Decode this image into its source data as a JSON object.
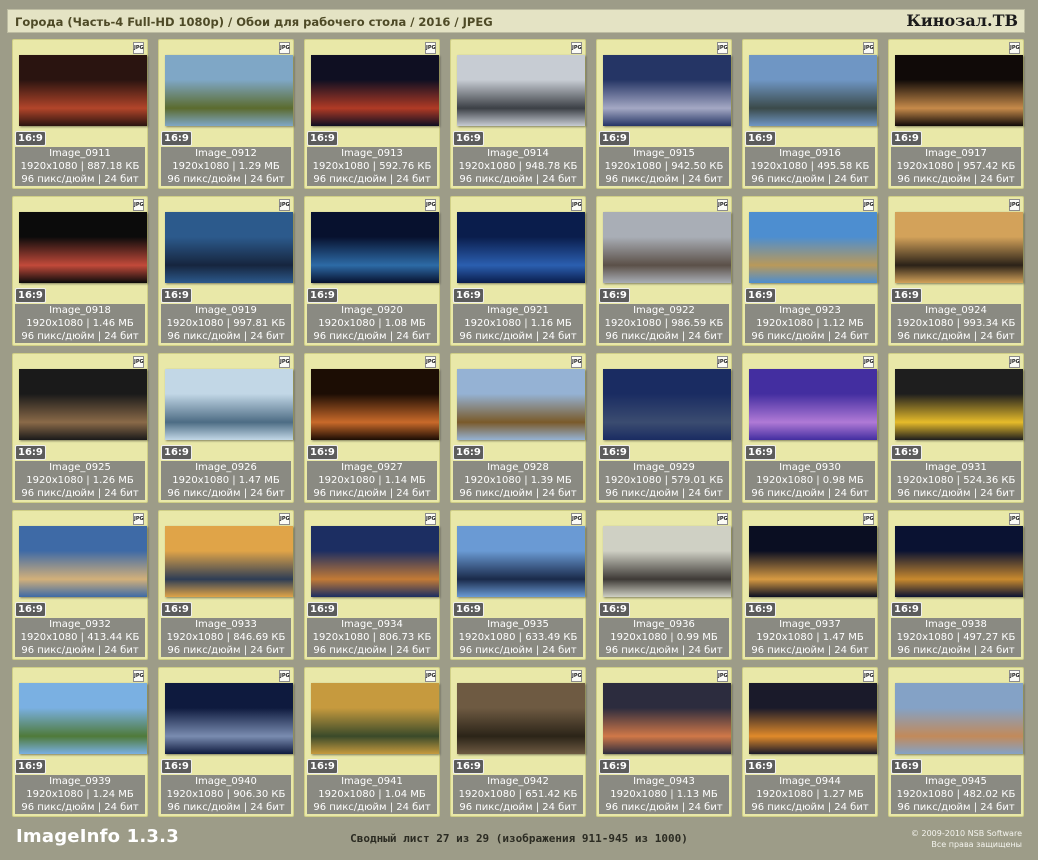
{
  "header": {
    "title": "Города (Часть-4 Full-HD 1080p) / Обои для рабочего стола / 2016 / JPEG",
    "brand": "Кинозал.ТВ"
  },
  "tile_format_badge": "JPG",
  "images": [
    {
      "name": "Image_0911",
      "aspect": "16:9",
      "dims": "1920x1080 | 887.18 КБ",
      "meta": "96 пикс/дюйм | 24 бит"
    },
    {
      "name": "Image_0912",
      "aspect": "16:9",
      "dims": "1920x1080 | 1.29 МБ",
      "meta": "96 пикс/дюйм | 24 бит"
    },
    {
      "name": "Image_0913",
      "aspect": "16:9",
      "dims": "1920x1080 | 592.76 КБ",
      "meta": "96 пикс/дюйм | 24 бит"
    },
    {
      "name": "Image_0914",
      "aspect": "16:9",
      "dims": "1920x1080 | 948.78 КБ",
      "meta": "96 пикс/дюйм | 24 бит"
    },
    {
      "name": "Image_0915",
      "aspect": "16:9",
      "dims": "1920x1080 | 942.50 КБ",
      "meta": "96 пикс/дюйм | 24 бит"
    },
    {
      "name": "Image_0916",
      "aspect": "16:9",
      "dims": "1920x1080 | 495.58 КБ",
      "meta": "96 пикс/дюйм | 24 бит"
    },
    {
      "name": "Image_0917",
      "aspect": "16:9",
      "dims": "1920x1080 | 957.42 КБ",
      "meta": "96 пикс/дюйм | 24 бит"
    },
    {
      "name": "Image_0918",
      "aspect": "16:9",
      "dims": "1920x1080 | 1.46 МБ",
      "meta": "96 пикс/дюйм | 24 бит"
    },
    {
      "name": "Image_0919",
      "aspect": "16:9",
      "dims": "1920x1080 | 997.81 КБ",
      "meta": "96 пикс/дюйм | 24 бит"
    },
    {
      "name": "Image_0920",
      "aspect": "16:9",
      "dims": "1920x1080 | 1.08 МБ",
      "meta": "96 пикс/дюйм | 24 бит"
    },
    {
      "name": "Image_0921",
      "aspect": "16:9",
      "dims": "1920x1080 | 1.16 МБ",
      "meta": "96 пикс/дюйм | 24 бит"
    },
    {
      "name": "Image_0922",
      "aspect": "16:9",
      "dims": "1920x1080 | 986.59 КБ",
      "meta": "96 пикс/дюйм | 24 бит"
    },
    {
      "name": "Image_0923",
      "aspect": "16:9",
      "dims": "1920x1080 | 1.12 МБ",
      "meta": "96 пикс/дюйм | 24 бит"
    },
    {
      "name": "Image_0924",
      "aspect": "16:9",
      "dims": "1920x1080 | 993.34 КБ",
      "meta": "96 пикс/дюйм | 24 бит"
    },
    {
      "name": "Image_0925",
      "aspect": "16:9",
      "dims": "1920x1080 | 1.26 МБ",
      "meta": "96 пикс/дюйм | 24 бит"
    },
    {
      "name": "Image_0926",
      "aspect": "16:9",
      "dims": "1920x1080 | 1.47 МБ",
      "meta": "96 пикс/дюйм | 24 бит"
    },
    {
      "name": "Image_0927",
      "aspect": "16:9",
      "dims": "1920x1080 | 1.14 МБ",
      "meta": "96 пикс/дюйм | 24 бит"
    },
    {
      "name": "Image_0928",
      "aspect": "16:9",
      "dims": "1920x1080 | 1.39 МБ",
      "meta": "96 пикс/дюйм | 24 бит"
    },
    {
      "name": "Image_0929",
      "aspect": "16:9",
      "dims": "1920x1080 | 579.01 КБ",
      "meta": "96 пикс/дюйм | 24 бит"
    },
    {
      "name": "Image_0930",
      "aspect": "16:9",
      "dims": "1920x1080 | 0.98 МБ",
      "meta": "96 пикс/дюйм | 24 бит"
    },
    {
      "name": "Image_0931",
      "aspect": "16:9",
      "dims": "1920x1080 | 524.36 КБ",
      "meta": "96 пикс/дюйм | 24 бит"
    },
    {
      "name": "Image_0932",
      "aspect": "16:9",
      "dims": "1920x1080 | 413.44 КБ",
      "meta": "96 пикс/дюйм | 24 бит"
    },
    {
      "name": "Image_0933",
      "aspect": "16:9",
      "dims": "1920x1080 | 846.69 КБ",
      "meta": "96 пикс/дюйм | 24 бит"
    },
    {
      "name": "Image_0934",
      "aspect": "16:9",
      "dims": "1920x1080 | 806.73 КБ",
      "meta": "96 пикс/дюйм | 24 бит"
    },
    {
      "name": "Image_0935",
      "aspect": "16:9",
      "dims": "1920x1080 | 633.49 КБ",
      "meta": "96 пикс/дюйм | 24 бит"
    },
    {
      "name": "Image_0936",
      "aspect": "16:9",
      "dims": "1920x1080 | 0.99 МБ",
      "meta": "96 пикс/дюйм | 24 бит"
    },
    {
      "name": "Image_0937",
      "aspect": "16:9",
      "dims": "1920x1080 | 1.47 МБ",
      "meta": "96 пикс/дюйм | 24 бит"
    },
    {
      "name": "Image_0938",
      "aspect": "16:9",
      "dims": "1920x1080 | 497.27 КБ",
      "meta": "96 пикс/дюйм | 24 бит"
    },
    {
      "name": "Image_0939",
      "aspect": "16:9",
      "dims": "1920x1080 | 1.24 МБ",
      "meta": "96 пикс/дюйм | 24 бит"
    },
    {
      "name": "Image_0940",
      "aspect": "16:9",
      "dims": "1920x1080 | 906.30 КБ",
      "meta": "96 пикс/дюйм | 24 бит"
    },
    {
      "name": "Image_0941",
      "aspect": "16:9",
      "dims": "1920x1080 | 1.04 МБ",
      "meta": "96 пикс/дюйм | 24 бит"
    },
    {
      "name": "Image_0942",
      "aspect": "16:9",
      "dims": "1920x1080 | 651.42 КБ",
      "meta": "96 пикс/дюйм | 24 бит"
    },
    {
      "name": "Image_0943",
      "aspect": "16:9",
      "dims": "1920x1080 | 1.13 МБ",
      "meta": "96 пикс/дюйм | 24 бит"
    },
    {
      "name": "Image_0944",
      "aspect": "16:9",
      "dims": "1920x1080 | 1.27 МБ",
      "meta": "96 пикс/дюйм | 24 бит"
    },
    {
      "name": "Image_0945",
      "aspect": "16:9",
      "dims": "1920x1080 | 482.02 КБ",
      "meta": "96 пикс/дюйм | 24 бит"
    }
  ],
  "thumb_colors": [
    [
      "#2a1410",
      "#b2452a"
    ],
    [
      "#7fa7c6",
      "#5b6b2e"
    ],
    [
      "#0f0f22",
      "#b03a25"
    ],
    [
      "#c7ccd3",
      "#3c4046"
    ],
    [
      "#253565",
      "#a4a8c4"
    ],
    [
      "#6f96c4",
      "#3b4a4a"
    ],
    [
      "#100a08",
      "#c68a4a"
    ],
    [
      "#0b0b0b",
      "#c24a3a"
    ],
    [
      "#2c5a8c",
      "#16253e"
    ],
    [
      "#07112e",
      "#2d6ba6"
    ],
    [
      "#0a1d4c",
      "#2b5fb0"
    ],
    [
      "#a9aeb6",
      "#5b5048"
    ],
    [
      "#4d8ed0",
      "#b9995a"
    ],
    [
      "#d3a25a",
      "#2b2218"
    ],
    [
      "#1a1a1a",
      "#8a6a48"
    ],
    [
      "#c2d7e6",
      "#4d6c84"
    ],
    [
      "#1c0d04",
      "#c96a2a"
    ],
    [
      "#95b2d4",
      "#7a5a2a"
    ],
    [
      "#1a2c62",
      "#3b4c70"
    ],
    [
      "#432ea0",
      "#b07ad6"
    ],
    [
      "#1e1e1e",
      "#e6bb2a"
    ],
    [
      "#3e6aa6",
      "#d2b07a"
    ],
    [
      "#e0a448",
      "#2e3d55"
    ],
    [
      "#1c2e62",
      "#c27a36"
    ],
    [
      "#6a9ad4",
      "#1a2a4a"
    ],
    [
      "#cfd0c4",
      "#3e3a36"
    ],
    [
      "#0a0e22",
      "#d79a42"
    ],
    [
      "#0a1232",
      "#c8892e"
    ],
    [
      "#7ab0e2",
      "#4f7a3a"
    ],
    [
      "#0e1a3e",
      "#7a8cb0"
    ],
    [
      "#c69a3e",
      "#3a4a2a"
    ],
    [
      "#6e5a42",
      "#2b2418"
    ],
    [
      "#2c2c3e",
      "#d07848"
    ],
    [
      "#1a1a2a",
      "#e08a2a"
    ],
    [
      "#84a2c6",
      "#c28a5a"
    ]
  ],
  "footer": {
    "app": "ImageInfo 1.3.3",
    "summary": "Сводный лист 27 из 29 (изображения 911-945 из 1000)",
    "copyright_line1": "© 2009-2010 NSB Software",
    "copyright_line2": "Все права защищены"
  }
}
